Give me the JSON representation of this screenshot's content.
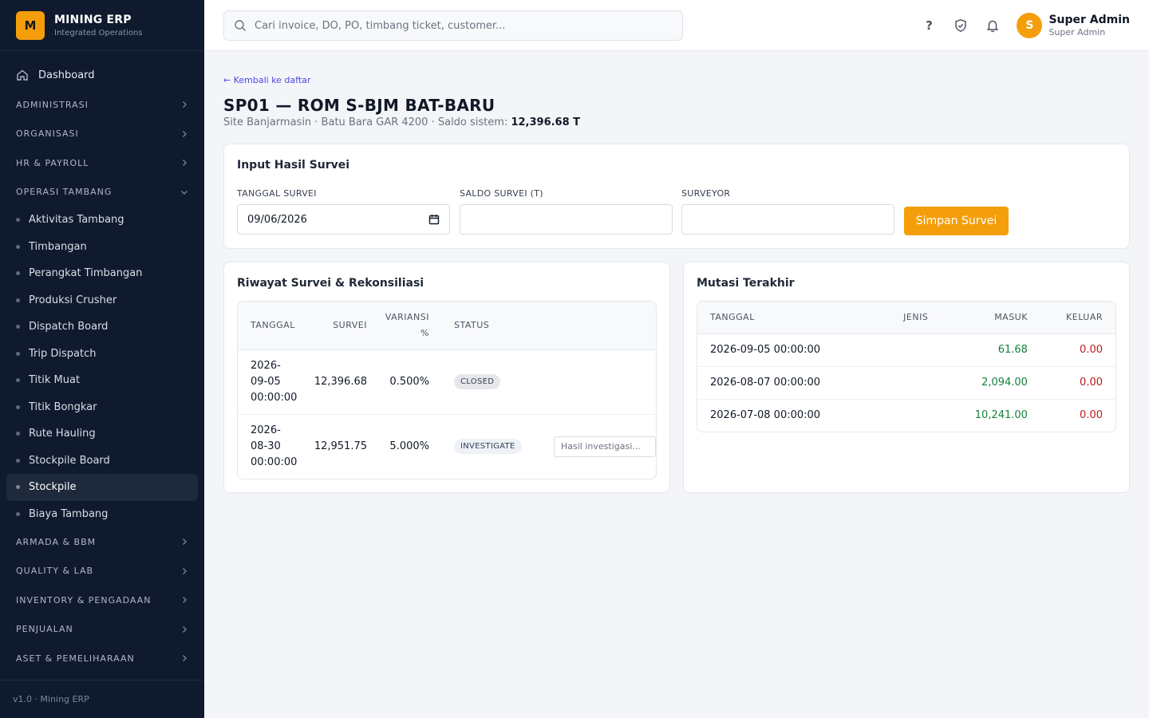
{
  "brand": {
    "logo_letter": "M",
    "name": "MINING ERP",
    "subtitle": "Integrated Operations"
  },
  "sidebar": {
    "dashboard": "Dashboard",
    "sections_top": [
      "ADMINISTRASI",
      "ORGANISASI",
      "HR & PAYROLL"
    ],
    "open_section": "OPERASI TAMBANG",
    "sub_items": [
      "Aktivitas Tambang",
      "Timbangan",
      "Perangkat Timbangan",
      "Produksi Crusher",
      "Dispatch Board",
      "Trip Dispatch",
      "Titik Muat",
      "Titik Bongkar",
      "Rute Hauling",
      "Stockpile Board",
      "Stockpile",
      "Biaya Tambang"
    ],
    "active_item": "Stockpile",
    "sections_bottom": [
      "ARMADA & BBM",
      "QUALITY & LAB",
      "INVENTORY & PENGADAAN",
      "PENJUALAN",
      "ASET & PEMELIHARAAN"
    ],
    "footer": "v1.0 · Mining ERP"
  },
  "header": {
    "search_placeholder": "Cari invoice, DO, PO, timbang ticket, customer...",
    "help_label": "?",
    "avatar_letter": "S",
    "user_name": "Super Admin",
    "user_role": "Super Admin"
  },
  "page": {
    "back": "← Kembali ke daftar",
    "title": "SP01 — ROM S-BJM BAT-BARU",
    "subtitle_prefix": "Site Banjarmasin · Batu Bara GAR 4200 · Saldo sistem: ",
    "saldo": "12,396.68 T"
  },
  "input_card": {
    "title": "Input Hasil Survei",
    "date_label": "TANGGAL SURVEI",
    "date_value": "09/06/2026",
    "saldo_label": "SALDO SURVEI (T)",
    "saldo_value": "",
    "surveyor_label": "SURVEYOR",
    "surveyor_value": "",
    "save_button": "Simpan Survei"
  },
  "riwayat": {
    "title": "Riwayat Survei & Rekonsiliasi",
    "headers": {
      "tanggal": "TANGGAL",
      "survei": "SURVEI",
      "varians_1": "VARIANSI",
      "varians_2": "%",
      "status": "STATUS"
    },
    "rows": [
      {
        "date_1": "2026-",
        "date_2": "09-05",
        "date_3": "00:00:00",
        "survei": "12,396.68",
        "varians": "0.500%",
        "status": "CLOSED"
      },
      {
        "date_1": "2026-",
        "date_2": "08-30",
        "date_3": "00:00:00",
        "survei": "12,951.75",
        "varians": "5.000%",
        "status": "INVESTIGATE",
        "note_placeholder": "Hasil investigasi..."
      }
    ]
  },
  "mutasi": {
    "title": "Mutasi Terakhir",
    "headers": {
      "tanggal": "TANGGAL",
      "jenis": "JENIS",
      "masuk": "MASUK",
      "keluar": "KELUAR"
    },
    "rows": [
      {
        "tanggal": "2026-09-05 00:00:00",
        "jenis": "",
        "masuk": "61.68",
        "keluar": "0.00"
      },
      {
        "tanggal": "2026-08-07 00:00:00",
        "jenis": "",
        "masuk": "2,094.00",
        "keluar": "0.00"
      },
      {
        "tanggal": "2026-07-08 00:00:00",
        "jenis": "",
        "masuk": "10,241.00",
        "keluar": "0.00"
      }
    ]
  },
  "colors": {
    "accent": "#f59e0b",
    "sidebar_bg": "#0f1a2e",
    "link": "#4f46e5",
    "positive": "#15803d",
    "negative": "#b91c1c"
  },
  "icons": {
    "search": "search-icon",
    "help": "help-icon",
    "shield": "shield-check-icon",
    "bell": "bell-icon",
    "home": "home-icon",
    "calendar": "calendar-icon",
    "chevron": "chevron-right-icon"
  }
}
